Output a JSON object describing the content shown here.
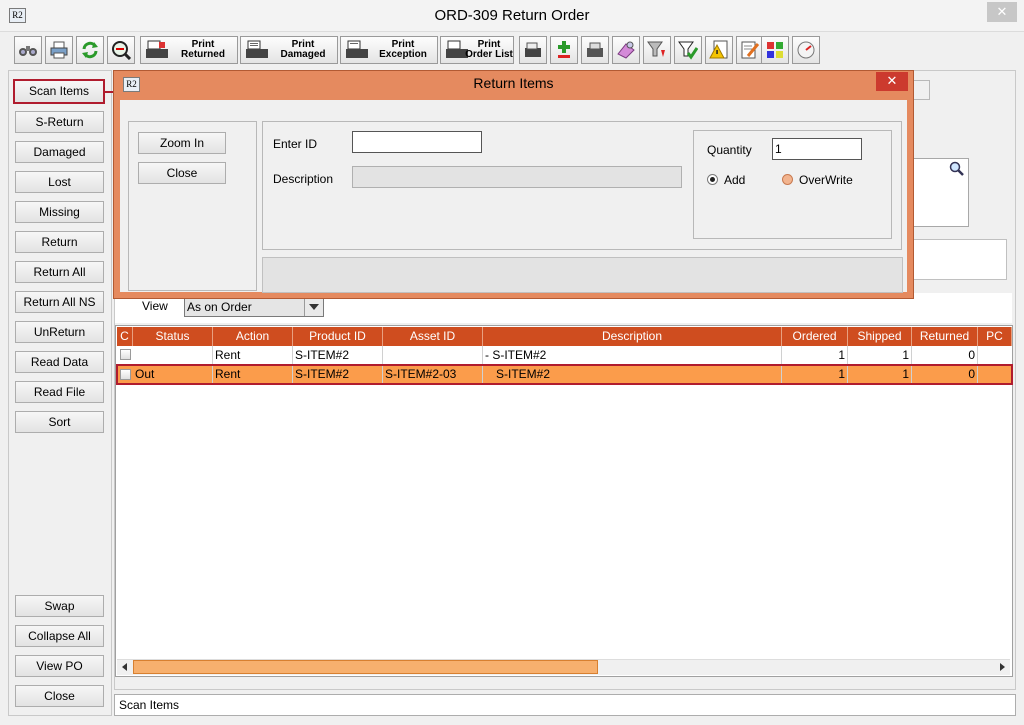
{
  "window": {
    "title": "ORD-309 Return Order",
    "logo_text": "R2",
    "close_glyph": "✕"
  },
  "toolbar": {
    "print_returned": [
      "Print",
      "Returned"
    ],
    "print_damaged": [
      "Print",
      "Damaged"
    ],
    "print_exception": [
      "Print",
      "Exception"
    ],
    "print_order_list": [
      "Print",
      "Order List"
    ]
  },
  "left_buttons": [
    "Scan Items",
    "S-Return",
    "Damaged",
    "Lost",
    "Missing",
    "Return",
    "Return All",
    "Return All NS",
    "UnReturn",
    "Read Data",
    "Read File",
    "Sort"
  ],
  "left_bottom_buttons": [
    "Swap",
    "Collapse All",
    "View PO",
    "Close"
  ],
  "view": {
    "label": "View",
    "value": "As on Order"
  },
  "grid": {
    "columns": [
      "C",
      "Status",
      "Action",
      "Product ID",
      "Asset ID",
      "Description",
      "Ordered",
      "Shipped",
      "Returned",
      "PC"
    ],
    "rows": [
      {
        "status": "",
        "action": "Rent",
        "product_id": "S-ITEM#2",
        "asset_id": "",
        "description": "- S-ITEM#2",
        "ordered": "1",
        "shipped": "1",
        "returned": "0"
      },
      {
        "status": "Out",
        "action": "Rent",
        "product_id": "S-ITEM#2",
        "asset_id": "S-ITEM#2-03",
        "description": "S-ITEM#2",
        "ordered": "1",
        "shipped": "1",
        "returned": "0"
      }
    ]
  },
  "status_bar": {
    "text": "Scan Items"
  },
  "dialog": {
    "title": "Return Items",
    "logo_text": "R2",
    "close_glyph": "✕",
    "zoom_in": "Zoom In",
    "close": "Close",
    "enter_id_label": "Enter ID",
    "enter_id_value": "",
    "description_label": "Description",
    "quantity_label": "Quantity",
    "quantity_value": "1",
    "add_label": "Add",
    "overwrite_label": "OverWrite",
    "mode": "Add"
  },
  "colors": {
    "accent": "#cf4d1f",
    "selection": "#fb9c4b",
    "dialog_frame": "#e58a5f",
    "highlight_border": "#b01c2e"
  }
}
